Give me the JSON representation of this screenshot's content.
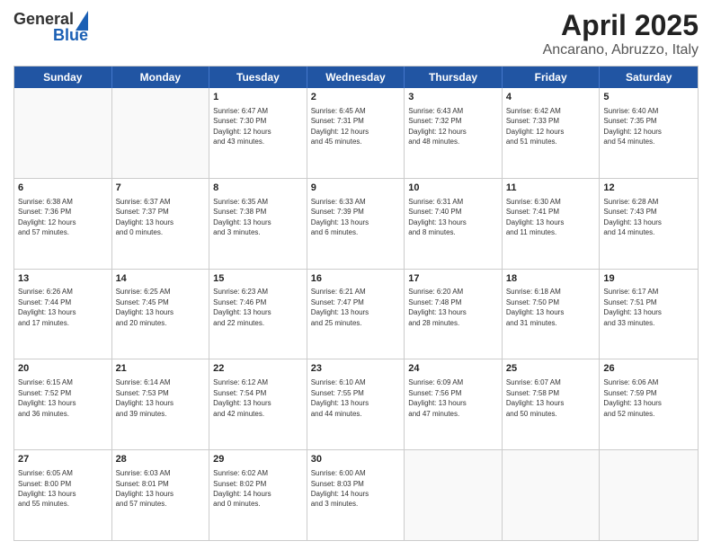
{
  "header": {
    "logo_line1": "General",
    "logo_line2": "Blue",
    "title": "April 2025",
    "subtitle": "Ancarano, Abruzzo, Italy"
  },
  "calendar": {
    "days_of_week": [
      "Sunday",
      "Monday",
      "Tuesday",
      "Wednesday",
      "Thursday",
      "Friday",
      "Saturday"
    ],
    "rows": [
      [
        {
          "day": "",
          "text": ""
        },
        {
          "day": "",
          "text": ""
        },
        {
          "day": "1",
          "text": "Sunrise: 6:47 AM\nSunset: 7:30 PM\nDaylight: 12 hours\nand 43 minutes."
        },
        {
          "day": "2",
          "text": "Sunrise: 6:45 AM\nSunset: 7:31 PM\nDaylight: 12 hours\nand 45 minutes."
        },
        {
          "day": "3",
          "text": "Sunrise: 6:43 AM\nSunset: 7:32 PM\nDaylight: 12 hours\nand 48 minutes."
        },
        {
          "day": "4",
          "text": "Sunrise: 6:42 AM\nSunset: 7:33 PM\nDaylight: 12 hours\nand 51 minutes."
        },
        {
          "day": "5",
          "text": "Sunrise: 6:40 AM\nSunset: 7:35 PM\nDaylight: 12 hours\nand 54 minutes."
        }
      ],
      [
        {
          "day": "6",
          "text": "Sunrise: 6:38 AM\nSunset: 7:36 PM\nDaylight: 12 hours\nand 57 minutes."
        },
        {
          "day": "7",
          "text": "Sunrise: 6:37 AM\nSunset: 7:37 PM\nDaylight: 13 hours\nand 0 minutes."
        },
        {
          "day": "8",
          "text": "Sunrise: 6:35 AM\nSunset: 7:38 PM\nDaylight: 13 hours\nand 3 minutes."
        },
        {
          "day": "9",
          "text": "Sunrise: 6:33 AM\nSunset: 7:39 PM\nDaylight: 13 hours\nand 6 minutes."
        },
        {
          "day": "10",
          "text": "Sunrise: 6:31 AM\nSunset: 7:40 PM\nDaylight: 13 hours\nand 8 minutes."
        },
        {
          "day": "11",
          "text": "Sunrise: 6:30 AM\nSunset: 7:41 PM\nDaylight: 13 hours\nand 11 minutes."
        },
        {
          "day": "12",
          "text": "Sunrise: 6:28 AM\nSunset: 7:43 PM\nDaylight: 13 hours\nand 14 minutes."
        }
      ],
      [
        {
          "day": "13",
          "text": "Sunrise: 6:26 AM\nSunset: 7:44 PM\nDaylight: 13 hours\nand 17 minutes."
        },
        {
          "day": "14",
          "text": "Sunrise: 6:25 AM\nSunset: 7:45 PM\nDaylight: 13 hours\nand 20 minutes."
        },
        {
          "day": "15",
          "text": "Sunrise: 6:23 AM\nSunset: 7:46 PM\nDaylight: 13 hours\nand 22 minutes."
        },
        {
          "day": "16",
          "text": "Sunrise: 6:21 AM\nSunset: 7:47 PM\nDaylight: 13 hours\nand 25 minutes."
        },
        {
          "day": "17",
          "text": "Sunrise: 6:20 AM\nSunset: 7:48 PM\nDaylight: 13 hours\nand 28 minutes."
        },
        {
          "day": "18",
          "text": "Sunrise: 6:18 AM\nSunset: 7:50 PM\nDaylight: 13 hours\nand 31 minutes."
        },
        {
          "day": "19",
          "text": "Sunrise: 6:17 AM\nSunset: 7:51 PM\nDaylight: 13 hours\nand 33 minutes."
        }
      ],
      [
        {
          "day": "20",
          "text": "Sunrise: 6:15 AM\nSunset: 7:52 PM\nDaylight: 13 hours\nand 36 minutes."
        },
        {
          "day": "21",
          "text": "Sunrise: 6:14 AM\nSunset: 7:53 PM\nDaylight: 13 hours\nand 39 minutes."
        },
        {
          "day": "22",
          "text": "Sunrise: 6:12 AM\nSunset: 7:54 PM\nDaylight: 13 hours\nand 42 minutes."
        },
        {
          "day": "23",
          "text": "Sunrise: 6:10 AM\nSunset: 7:55 PM\nDaylight: 13 hours\nand 44 minutes."
        },
        {
          "day": "24",
          "text": "Sunrise: 6:09 AM\nSunset: 7:56 PM\nDaylight: 13 hours\nand 47 minutes."
        },
        {
          "day": "25",
          "text": "Sunrise: 6:07 AM\nSunset: 7:58 PM\nDaylight: 13 hours\nand 50 minutes."
        },
        {
          "day": "26",
          "text": "Sunrise: 6:06 AM\nSunset: 7:59 PM\nDaylight: 13 hours\nand 52 minutes."
        }
      ],
      [
        {
          "day": "27",
          "text": "Sunrise: 6:05 AM\nSunset: 8:00 PM\nDaylight: 13 hours\nand 55 minutes."
        },
        {
          "day": "28",
          "text": "Sunrise: 6:03 AM\nSunset: 8:01 PM\nDaylight: 13 hours\nand 57 minutes."
        },
        {
          "day": "29",
          "text": "Sunrise: 6:02 AM\nSunset: 8:02 PM\nDaylight: 14 hours\nand 0 minutes."
        },
        {
          "day": "30",
          "text": "Sunrise: 6:00 AM\nSunset: 8:03 PM\nDaylight: 14 hours\nand 3 minutes."
        },
        {
          "day": "",
          "text": ""
        },
        {
          "day": "",
          "text": ""
        },
        {
          "day": "",
          "text": ""
        }
      ]
    ]
  }
}
